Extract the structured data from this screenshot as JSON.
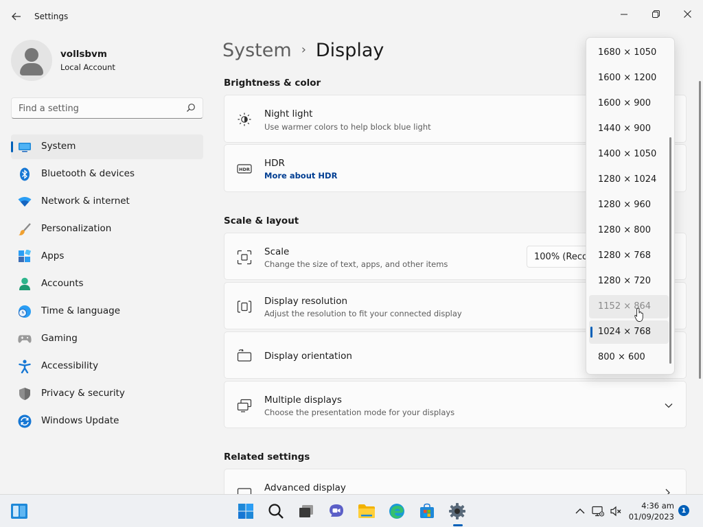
{
  "window": {
    "title": "Settings",
    "back_icon": "back-arrow-icon",
    "minimize_icon": "minimize-icon",
    "maximize_icon": "restore-icon",
    "close_icon": "close-icon"
  },
  "user": {
    "name": "vollsbvm",
    "account_type": "Local Account"
  },
  "search": {
    "placeholder": "Find a setting",
    "value": ""
  },
  "sidebar": {
    "selected": "System",
    "items": [
      {
        "label": "System",
        "icon": "system-display-icon"
      },
      {
        "label": "Bluetooth & devices",
        "icon": "bluetooth-icon"
      },
      {
        "label": "Network & internet",
        "icon": "wifi-icon"
      },
      {
        "label": "Personalization",
        "icon": "brush-icon"
      },
      {
        "label": "Apps",
        "icon": "apps-icon"
      },
      {
        "label": "Accounts",
        "icon": "person-icon"
      },
      {
        "label": "Time & language",
        "icon": "globe-clock-icon"
      },
      {
        "label": "Gaming",
        "icon": "controller-icon"
      },
      {
        "label": "Accessibility",
        "icon": "accessibility-icon"
      },
      {
        "label": "Privacy & security",
        "icon": "shield-icon"
      },
      {
        "label": "Windows Update",
        "icon": "update-icon"
      }
    ]
  },
  "breadcrumb": {
    "parent": "System",
    "separator": "›",
    "current": "Display"
  },
  "sections": {
    "brightness": "Brightness & color",
    "scale_layout": "Scale & layout",
    "related": "Related settings"
  },
  "cards": {
    "night_light": {
      "title": "Night light",
      "desc": "Use warmer colors to help block blue light"
    },
    "hdr": {
      "title": "HDR",
      "link": "More about HDR"
    },
    "scale": {
      "title": "Scale",
      "desc": "Change the size of text, apps, and other items",
      "value": "100% (Recommended)"
    },
    "resolution": {
      "title": "Display resolution",
      "desc": "Adjust the resolution to fit your connected display"
    },
    "orientation": {
      "title": "Display orientation"
    },
    "multiple": {
      "title": "Multiple displays",
      "desc": "Choose the presentation mode for your displays"
    },
    "advanced": {
      "title": "Advanced display"
    }
  },
  "resolution_dropdown": {
    "selected": "1024 × 768",
    "hovered": "1152 × 864",
    "options": [
      "1680 × 1050",
      "1600 × 1200",
      "1600 × 900",
      "1440 × 900",
      "1400 × 1050",
      "1280 × 1024",
      "1280 × 960",
      "1280 × 800",
      "1280 × 768",
      "1280 × 720",
      "1152 × 864",
      "1024 × 768",
      "800 × 600"
    ]
  },
  "taskbar": {
    "apps": [
      "windows-start-icon",
      "search-icon",
      "task-view-icon",
      "chat-icon",
      "file-explorer-icon",
      "edge-icon",
      "store-icon",
      "settings-icon"
    ],
    "active_app": "settings-icon",
    "time": "4:36 am",
    "date": "01/09/2023",
    "notification_count": "1"
  },
  "colors": {
    "accent": "#005fb8",
    "link": "#003e92",
    "background": "#f3f3f3",
    "card": "#fbfbfb"
  }
}
